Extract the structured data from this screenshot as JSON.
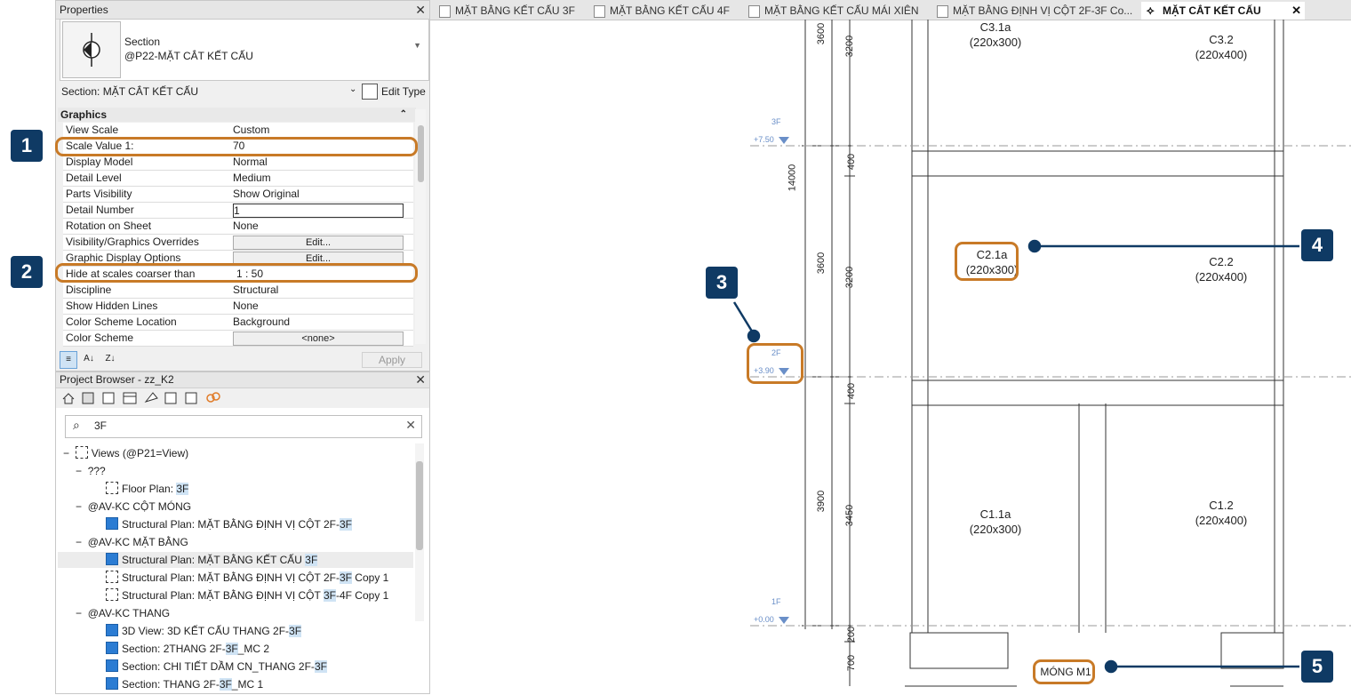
{
  "properties": {
    "title": "Properties",
    "type_name": "Section",
    "type_sub": "@P22-MẶT CẮT KẾT CẤU",
    "section_selector": "Section: MẶT CẮT KẾT CẤU",
    "edit_type_label": "Edit Type",
    "group_label": "Graphics",
    "rows": [
      {
        "name": "View Scale",
        "value": "Custom"
      },
      {
        "name": "Scale Value    1:",
        "value": "70"
      },
      {
        "name": "Display Model",
        "value": "Normal"
      },
      {
        "name": "Detail Level",
        "value": "Medium"
      },
      {
        "name": "Parts Visibility",
        "value": "Show Original"
      },
      {
        "name": "Detail Number",
        "value": "1"
      },
      {
        "name": "Rotation on Sheet",
        "value": "None"
      },
      {
        "name": "Visibility/Graphics Overrides",
        "value": "Edit..."
      },
      {
        "name": "Graphic Display Options",
        "value": "Edit..."
      },
      {
        "name": "Hide at scales coarser than",
        "value": "1 : 50"
      },
      {
        "name": "Discipline",
        "value": "Structural"
      },
      {
        "name": "Show Hidden Lines",
        "value": "None"
      },
      {
        "name": "Color Scheme Location",
        "value": "Background"
      },
      {
        "name": "Color Scheme",
        "value": "<none>"
      }
    ],
    "apply_label": "Apply"
  },
  "browser": {
    "title": "Project Browser - zz_K2",
    "search_value": "3F",
    "items": [
      {
        "label": "Views (@P21=View)"
      },
      {
        "label": "???"
      },
      {
        "label": "Floor Plan: ",
        "hl": "3F",
        "rest": ""
      },
      {
        "label": "@AV-KC CỘT MÓNG"
      },
      {
        "label": "Structural Plan: MẶT BẰNG ĐỊNH VỊ CỘT 2F-",
        "hl": "3F",
        "rest": ""
      },
      {
        "label": "@AV-KC MẶT BẰNG"
      },
      {
        "label": "Structural Plan: MẶT BẰNG KẾT CẤU ",
        "hl": "3F",
        "rest": ""
      },
      {
        "label": "Structural Plan: MẶT BẰNG ĐỊNH VỊ CỘT 2F-",
        "hl": "3F",
        "rest": " Copy 1"
      },
      {
        "label": "Structural Plan: MẶT BẰNG ĐỊNH VỊ CỘT ",
        "hl": "3F",
        "rest": "-4F Copy 1"
      },
      {
        "label": "@AV-KC THANG"
      },
      {
        "label": "3D View: 3D KẾT CẤU THANG 2F-",
        "hl": "3F",
        "rest": ""
      },
      {
        "label": "Section: 2THANG 2F-",
        "hl": "3F",
        "rest": "_MC 2"
      },
      {
        "label": "Section: CHI TIẾT DẦM CN_THANG 2F-",
        "hl": "3F",
        "rest": ""
      },
      {
        "label": "Section: THANG 2F-",
        "hl": "3F",
        "rest": "_MC 1"
      }
    ]
  },
  "tabs": [
    {
      "label": "MẶT BẰNG KẾT CẤU 3F"
    },
    {
      "label": "MẶT BẰNG KẾT CẤU 4F"
    },
    {
      "label": "MẶT BẰNG KẾT CẤU MÁI XIÊN"
    },
    {
      "label": "MẶT BẰNG ĐỊNH VỊ CỘT 2F-3F Co..."
    },
    {
      "label": "MẶT CẮT KẾT CẤU"
    }
  ],
  "badges": [
    "1",
    "2",
    "3",
    "4",
    "5"
  ],
  "drawing": {
    "labels": {
      "c31a": "C3.1a",
      "c31a_s": "(220x300)",
      "c32": "C3.2",
      "c32_s": "(220x400)",
      "c21a": "C2.1a",
      "c21a_s": "(220x300)",
      "c22": "C2.2",
      "c22_s": "(220x400)",
      "c11a": "C1.1a",
      "c11a_s": "(220x300)",
      "c12": "C1.2",
      "c12_s": "(220x400)",
      "mong": "MÓNG M1"
    },
    "dims": {
      "d14000": "14000",
      "d3600a": "3600",
      "d3600b": "3600",
      "d3900": "3900",
      "d3200a": "3200",
      "d400a": "400",
      "d3200b": "3200",
      "d400b": "400",
      "d3450": "3450",
      "d200": "200",
      "d700": "700"
    },
    "levels": {
      "l3f": "3F",
      "e3f": "+7.50",
      "l2f": "2F",
      "e2f": "+3.90",
      "l1f": "1F",
      "e1f": "+0.00"
    }
  },
  "colors": {
    "badge": "#0f3a64",
    "highlight_ring": "#c87a27",
    "search_highlight": "#cfe3f4"
  }
}
